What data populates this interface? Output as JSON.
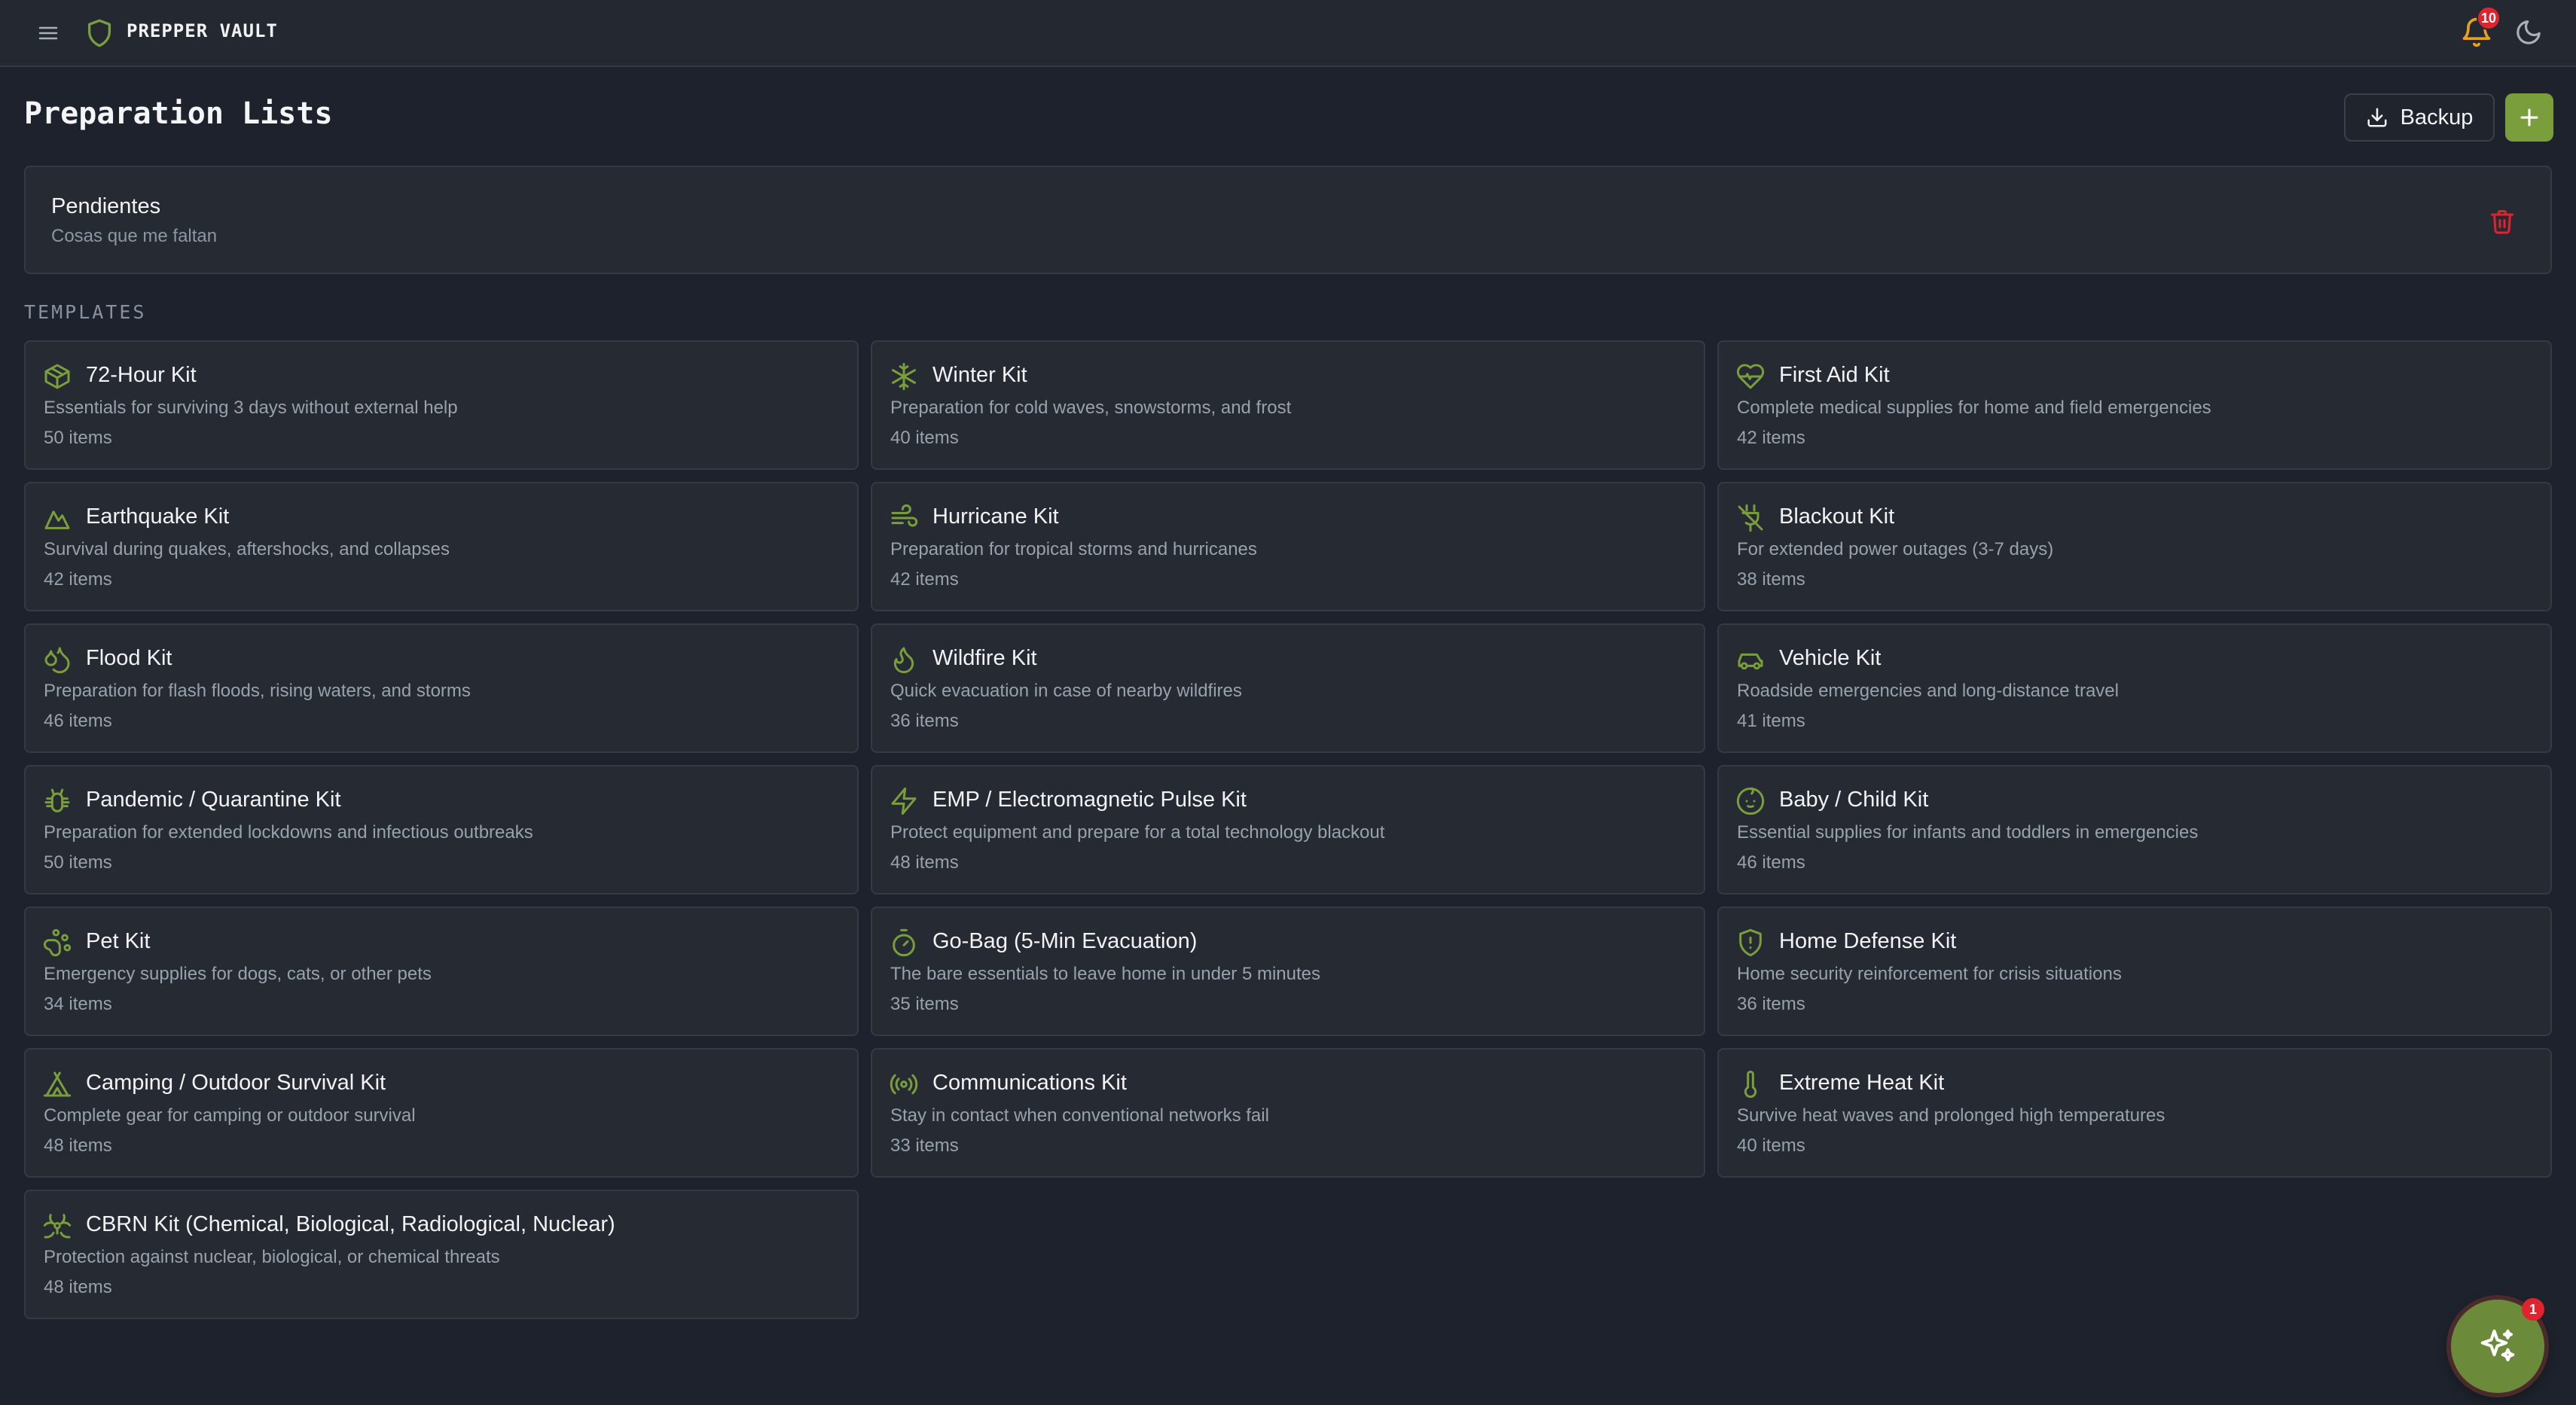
{
  "app": {
    "name": "PREPPER VAULT",
    "notifications": "10"
  },
  "page": {
    "title": "Preparation Lists",
    "backup_label": "Backup"
  },
  "user_lists": [
    {
      "name": "Pendientes",
      "description": "Cosas que me faltan"
    }
  ],
  "templates_label": "TEMPLATES",
  "templates": [
    {
      "icon": "box-icon",
      "title": "72-Hour Kit",
      "description": "Essentials for surviving 3 days without external help",
      "count": "50 items"
    },
    {
      "icon": "snowflake-icon",
      "title": "Winter Kit",
      "description": "Preparation for cold waves, snowstorms, and frost",
      "count": "40 items"
    },
    {
      "icon": "heart-pulse-icon",
      "title": "First Aid Kit",
      "description": "Complete medical supplies for home and field emergencies",
      "count": "42 items"
    },
    {
      "icon": "mountain-icon",
      "title": "Earthquake Kit",
      "description": "Survival during quakes, aftershocks, and collapses",
      "count": "42 items"
    },
    {
      "icon": "wind-icon",
      "title": "Hurricane Kit",
      "description": "Preparation for tropical storms and hurricanes",
      "count": "42 items"
    },
    {
      "icon": "plug-off-icon",
      "title": "Blackout Kit",
      "description": "For extended power outages (3-7 days)",
      "count": "38 items"
    },
    {
      "icon": "droplets-icon",
      "title": "Flood Kit",
      "description": "Preparation for flash floods, rising waters, and storms",
      "count": "46 items"
    },
    {
      "icon": "flame-icon",
      "title": "Wildfire Kit",
      "description": "Quick evacuation in case of nearby wildfires",
      "count": "36 items"
    },
    {
      "icon": "car-icon",
      "title": "Vehicle Kit",
      "description": "Roadside emergencies and long-distance travel",
      "count": "41 items"
    },
    {
      "icon": "bug-icon",
      "title": "Pandemic / Quarantine Kit",
      "description": "Preparation for extended lockdowns and infectious outbreaks",
      "count": "50 items"
    },
    {
      "icon": "zap-icon",
      "title": "EMP / Electromagnetic Pulse Kit",
      "description": "Protect equipment and prepare for a total technology blackout",
      "count": "48 items"
    },
    {
      "icon": "baby-icon",
      "title": "Baby / Child Kit",
      "description": "Essential supplies for infants and toddlers in emergencies",
      "count": "46 items"
    },
    {
      "icon": "paw-icon",
      "title": "Pet Kit",
      "description": "Emergency supplies for dogs, cats, or other pets",
      "count": "34 items"
    },
    {
      "icon": "timer-icon",
      "title": "Go-Bag (5-Min Evacuation)",
      "description": "The bare essentials to leave home in under 5 minutes",
      "count": "35 items"
    },
    {
      "icon": "shield-alert-icon",
      "title": "Home Defense Kit",
      "description": "Home security reinforcement for crisis situations",
      "count": "36 items"
    },
    {
      "icon": "tent-icon",
      "title": "Camping / Outdoor Survival Kit",
      "description": "Complete gear for camping or outdoor survival",
      "count": "48 items"
    },
    {
      "icon": "radio-icon",
      "title": "Communications Kit",
      "description": "Stay in contact when conventional networks fail",
      "count": "33 items"
    },
    {
      "icon": "thermometer-icon",
      "title": "Extreme Heat Kit",
      "description": "Survive heat waves and prolonged high temperatures",
      "count": "40 items"
    },
    {
      "icon": "biohazard-icon",
      "title": "CBRN Kit (Chemical, Biological, Radiological, Nuclear)",
      "description": "Protection against nuclear, biological, or chemical threats",
      "count": "48 items"
    }
  ],
  "assistant_badge": "1",
  "colors": {
    "accent": "#7a9e3c",
    "background": "#1d222c",
    "card": "#252a33",
    "danger": "#e0242f"
  }
}
